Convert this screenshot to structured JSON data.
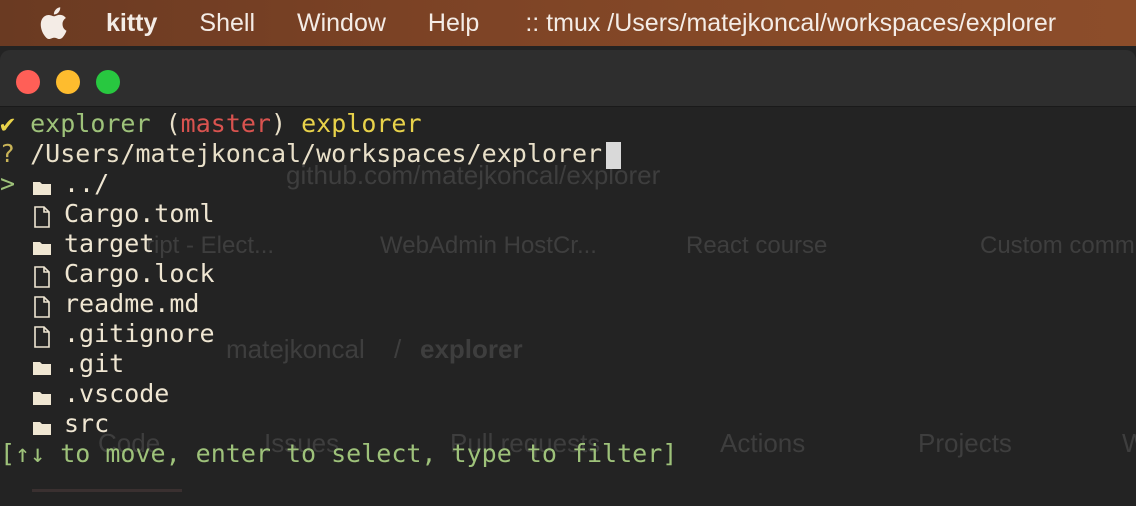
{
  "menubar": {
    "apple_icon": "apple-logo-icon",
    "app_name": "kitty",
    "items": [
      "Shell",
      "Window",
      "Help"
    ],
    "window_title": ":: tmux /Users/matejkoncal/workspaces/explorer"
  },
  "background_ghost": {
    "url": "github.com/matejkoncal/explorer",
    "bookmarks": [
      "ript - Elect...",
      "WebAdmin HostCr...",
      "React course",
      "Custom comm"
    ],
    "repo_owner": "matejkoncal",
    "repo_sep": "/",
    "repo_name": "explorer",
    "tabs": [
      "Code",
      "Issues",
      "Pull requests",
      "Actions",
      "Projects",
      "W"
    ]
  },
  "terminal": {
    "line1": {
      "mark": "✔",
      "dir": "explorer",
      "open": "(",
      "branch": "master",
      "close": ")",
      "cmd": "explorer"
    },
    "line2": {
      "mark": "?",
      "path": "/Users/matejkoncal/workspaces/explorer"
    },
    "selector": ">",
    "entries": [
      {
        "name": "../",
        "kind": "folder"
      },
      {
        "name": "Cargo.toml",
        "kind": "file"
      },
      {
        "name": "target",
        "kind": "folder"
      },
      {
        "name": "Cargo.lock",
        "kind": "file"
      },
      {
        "name": "readme.md",
        "kind": "file"
      },
      {
        "name": ".gitignore",
        "kind": "file"
      },
      {
        "name": ".git",
        "kind": "folder"
      },
      {
        "name": ".vscode",
        "kind": "folder"
      },
      {
        "name": "src",
        "kind": "folder"
      }
    ],
    "hint": "[↑↓ to move, enter to select, type to filter]"
  }
}
